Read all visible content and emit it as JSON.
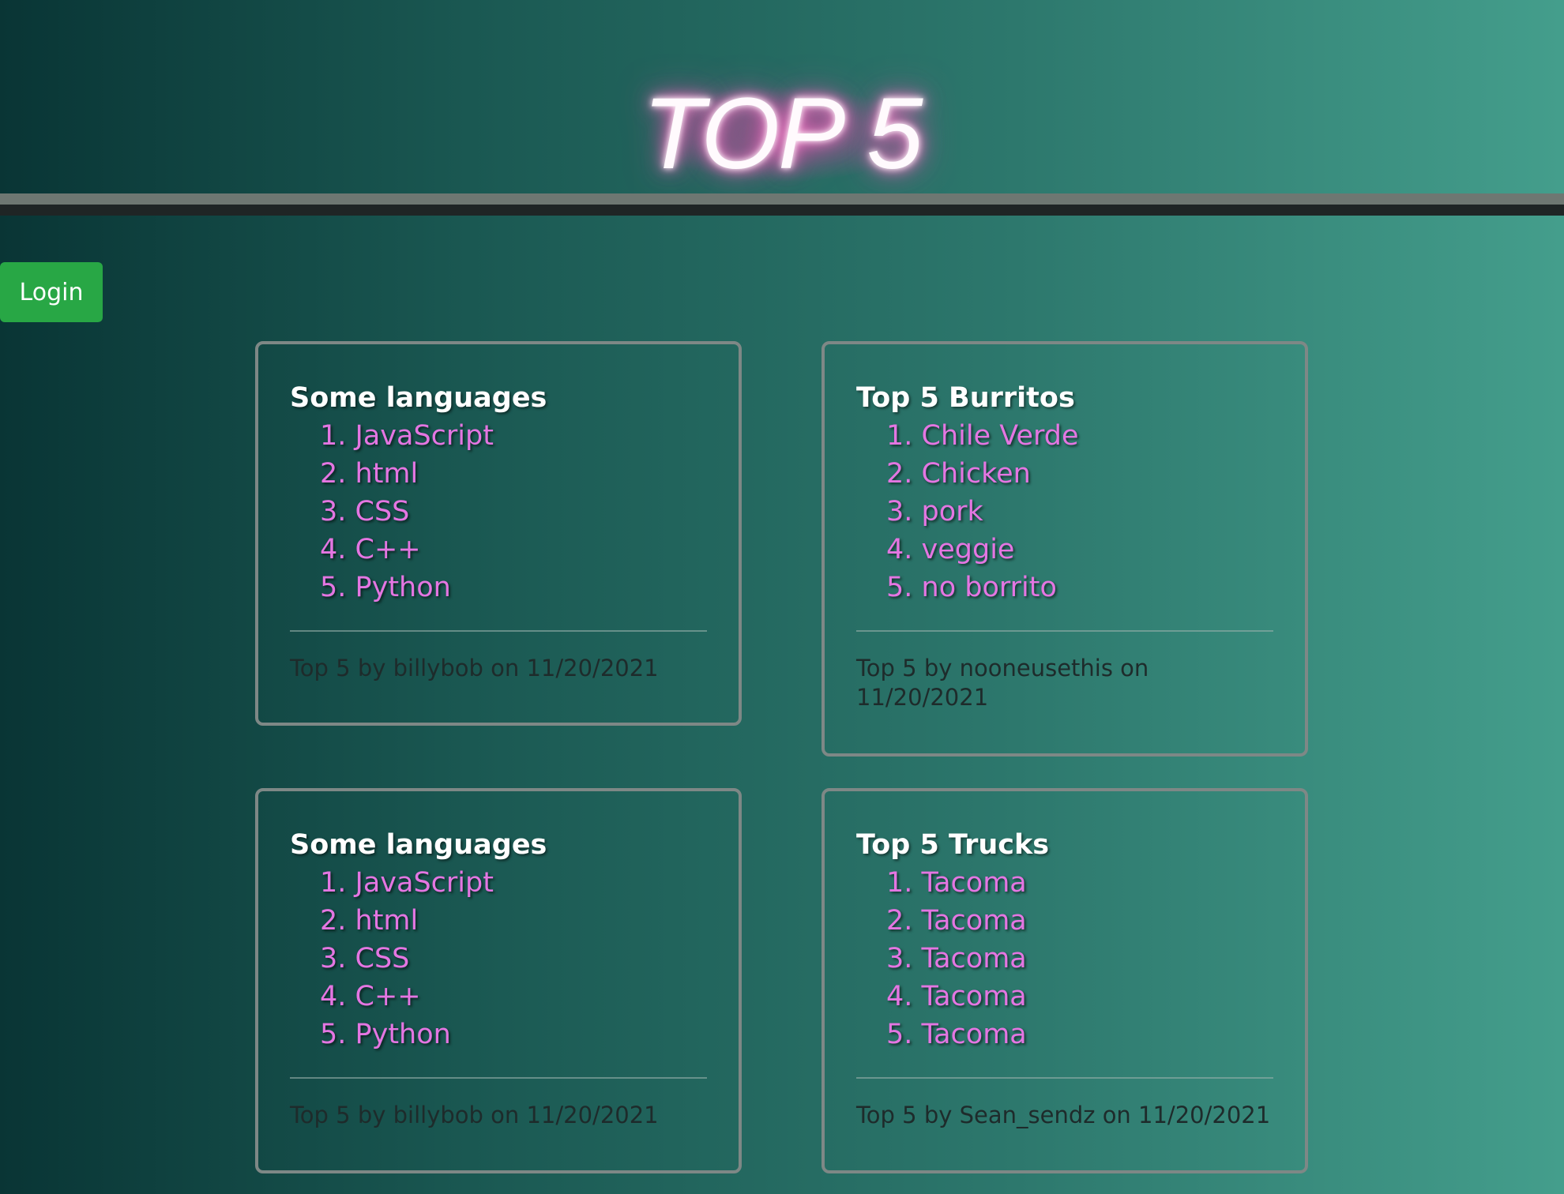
{
  "header": {
    "title": "TOP 5"
  },
  "auth": {
    "login_label": "Login"
  },
  "cards": [
    {
      "title": "Some languages",
      "items": [
        "1. JavaScript",
        "2. html",
        "3. CSS",
        "4. C++",
        "5. Python"
      ],
      "footer": "Top 5 by billybob on 11/20/2021"
    },
    {
      "title": "Top 5 Burritos",
      "items": [
        "1. Chile Verde",
        "2. Chicken",
        "3. pork",
        "4. veggie",
        "5. no borrito"
      ],
      "footer": "Top 5 by nooneusethis on 11/20/2021"
    },
    {
      "title": "Some languages",
      "items": [
        "1. JavaScript",
        "2. html",
        "3. CSS",
        "4. C++",
        "5. Python"
      ],
      "footer": "Top 5 by billybob on 11/20/2021"
    },
    {
      "title": "Top 5 Trucks",
      "items": [
        "1. Tacoma",
        "2. Tacoma",
        "3. Tacoma",
        "4. Tacoma",
        "5. Tacoma"
      ],
      "footer": "Top 5 by Sean_sendz on 11/20/2021"
    }
  ],
  "colors": {
    "item_text": "#e476e2",
    "login_button": "#28a745",
    "title_glow": "#e05bb0"
  }
}
